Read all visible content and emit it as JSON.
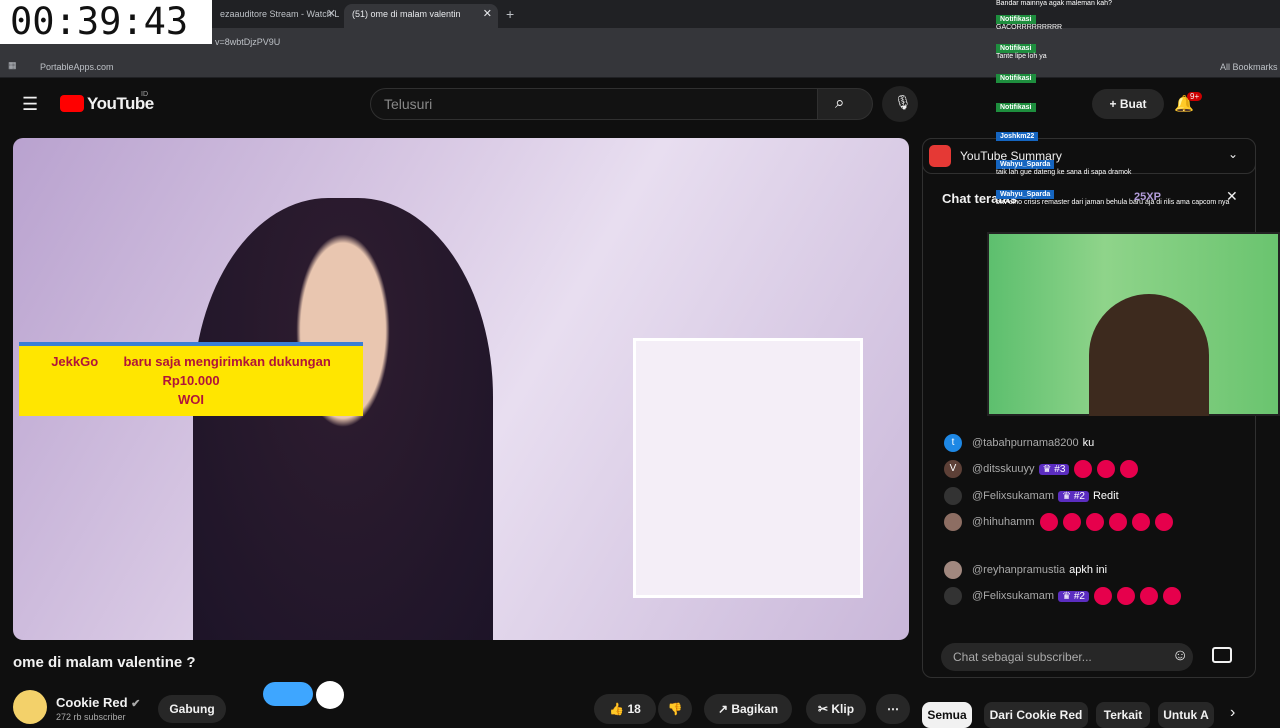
{
  "timer": "00:39:43",
  "browser": {
    "tabs": [
      {
        "label": "ezaauditore Stream - Watch L"
      },
      {
        "label": "(51) ome di malam valentin"
      }
    ],
    "url": "v=8wbtDjzPV9U",
    "bookmark": "PortableApps.com",
    "all_bookmarks": "All Bookmarks"
  },
  "youtube": {
    "logo": "YouTube",
    "region": "ID",
    "search_placeholder": "Telusuri",
    "create_label": "Buat",
    "notif_count": "9+"
  },
  "donation": {
    "name": "JekkGo",
    "text": "baru saja mengirimkan dukungan",
    "amount": "Rp10.000",
    "message": "WOI"
  },
  "video": {
    "title": "ome di malam valentine ?",
    "channel": "Cookie Red",
    "subscribers": "272 rb subscriber",
    "join_label": "Gabung",
    "likes": "18",
    "share_label": "Bagikan",
    "clip_label": "Klip"
  },
  "summary": {
    "label": "YouTube Summary"
  },
  "chat": {
    "title": "Chat teratas",
    "xp": "25XP",
    "messages": [
      {
        "user": "@tabahpurnama8200",
        "msg": "ku",
        "avatar_letter": "t",
        "color": "#1e88e5"
      },
      {
        "user": "@ditsskuuyy",
        "badge": "#3",
        "msg": "",
        "avatar_letter": "V",
        "color": "#5d4037"
      },
      {
        "user": "@Felixsukamam",
        "badge": "#2",
        "msg": "Redit",
        "avatar_letter": "",
        "color": "#333"
      },
      {
        "user": "@hihuhamm",
        "msg": "",
        "avatar_letter": "",
        "color": "#8d6e63"
      },
      {
        "user": "@reyhanpramustia",
        "msg": "apkh ini",
        "avatar_letter": "",
        "color": "#a1887f"
      },
      {
        "user": "@Felixsukamam",
        "badge": "#2",
        "msg": "",
        "avatar_letter": "",
        "color": "#333"
      }
    ],
    "input_placeholder": "Chat sebagai subscriber..."
  },
  "overlay": {
    "lines": [
      {
        "label": "",
        "text": "Bandar mainnya agak maleman kah?"
      },
      {
        "label": "Notifikasi",
        "text": "GACORRRRRRRRR"
      },
      {
        "label": "Notifikasi",
        "text": "Tante lipe loh ya"
      },
      {
        "label": "Notifikasi",
        "text": ""
      },
      {
        "label": "Notifikasi",
        "text": ""
      },
      {
        "label": "Joshkm22",
        "text": ""
      },
      {
        "label": "Wahyu_Sparda",
        "text": "taik lah gue dateng ke sana di sapa dramok"
      },
      {
        "label": "Wahyu_Sparda",
        "text": "btw dino crisis remaster dari jaman behula baru aja di rilis ama capcom nya"
      }
    ]
  },
  "chips": [
    "Semua",
    "Dari Cookie Red",
    "Terkait",
    "Untuk A"
  ]
}
